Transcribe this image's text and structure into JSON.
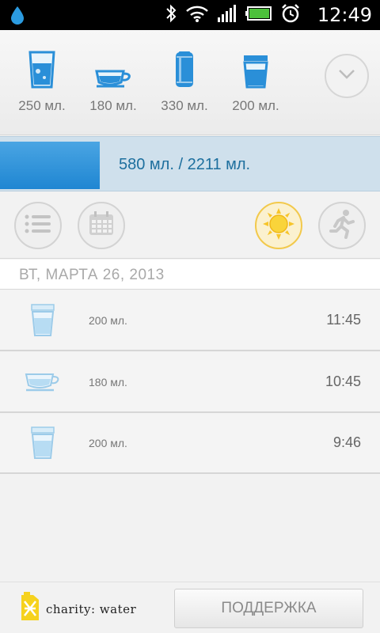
{
  "status_bar": {
    "time": "12:49",
    "icons": [
      "water-drop-icon",
      "bluetooth-icon",
      "wifi-icon",
      "signal-icon",
      "battery-icon",
      "alarm-icon"
    ]
  },
  "drinks": [
    {
      "icon": "glass-icon",
      "label": "250 мл."
    },
    {
      "icon": "cup-icon",
      "label": "180 мл."
    },
    {
      "icon": "can-icon",
      "label": "330 мл."
    },
    {
      "icon": "paper-cup-icon",
      "label": "200 мл."
    }
  ],
  "progress": {
    "text": "580 мл. / 2211 мл.",
    "consumed": 580,
    "goal": 2211
  },
  "toolbar": {
    "buttons": [
      "list-icon",
      "calendar-icon",
      "sun-icon",
      "running-icon"
    ],
    "active": "sun-icon"
  },
  "date_header": "ВТ, МАРТА 26, 2013",
  "entries": [
    {
      "icon": "paper-cup-icon",
      "amount": "200 мл.",
      "time": "11:45"
    },
    {
      "icon": "cup-icon",
      "amount": "180 мл.",
      "time": "10:45"
    },
    {
      "icon": "paper-cup-icon",
      "amount": "200 мл.",
      "time": "9:46"
    }
  ],
  "footer": {
    "charity": "charity: water",
    "support_label": "ПОДДЕРЖКА"
  },
  "colors": {
    "accent_blue": "#2a8fd8",
    "progress_track": "#cfe0ec",
    "sun_yellow": "#f7c52a",
    "charity_yellow": "#f6d21e"
  }
}
